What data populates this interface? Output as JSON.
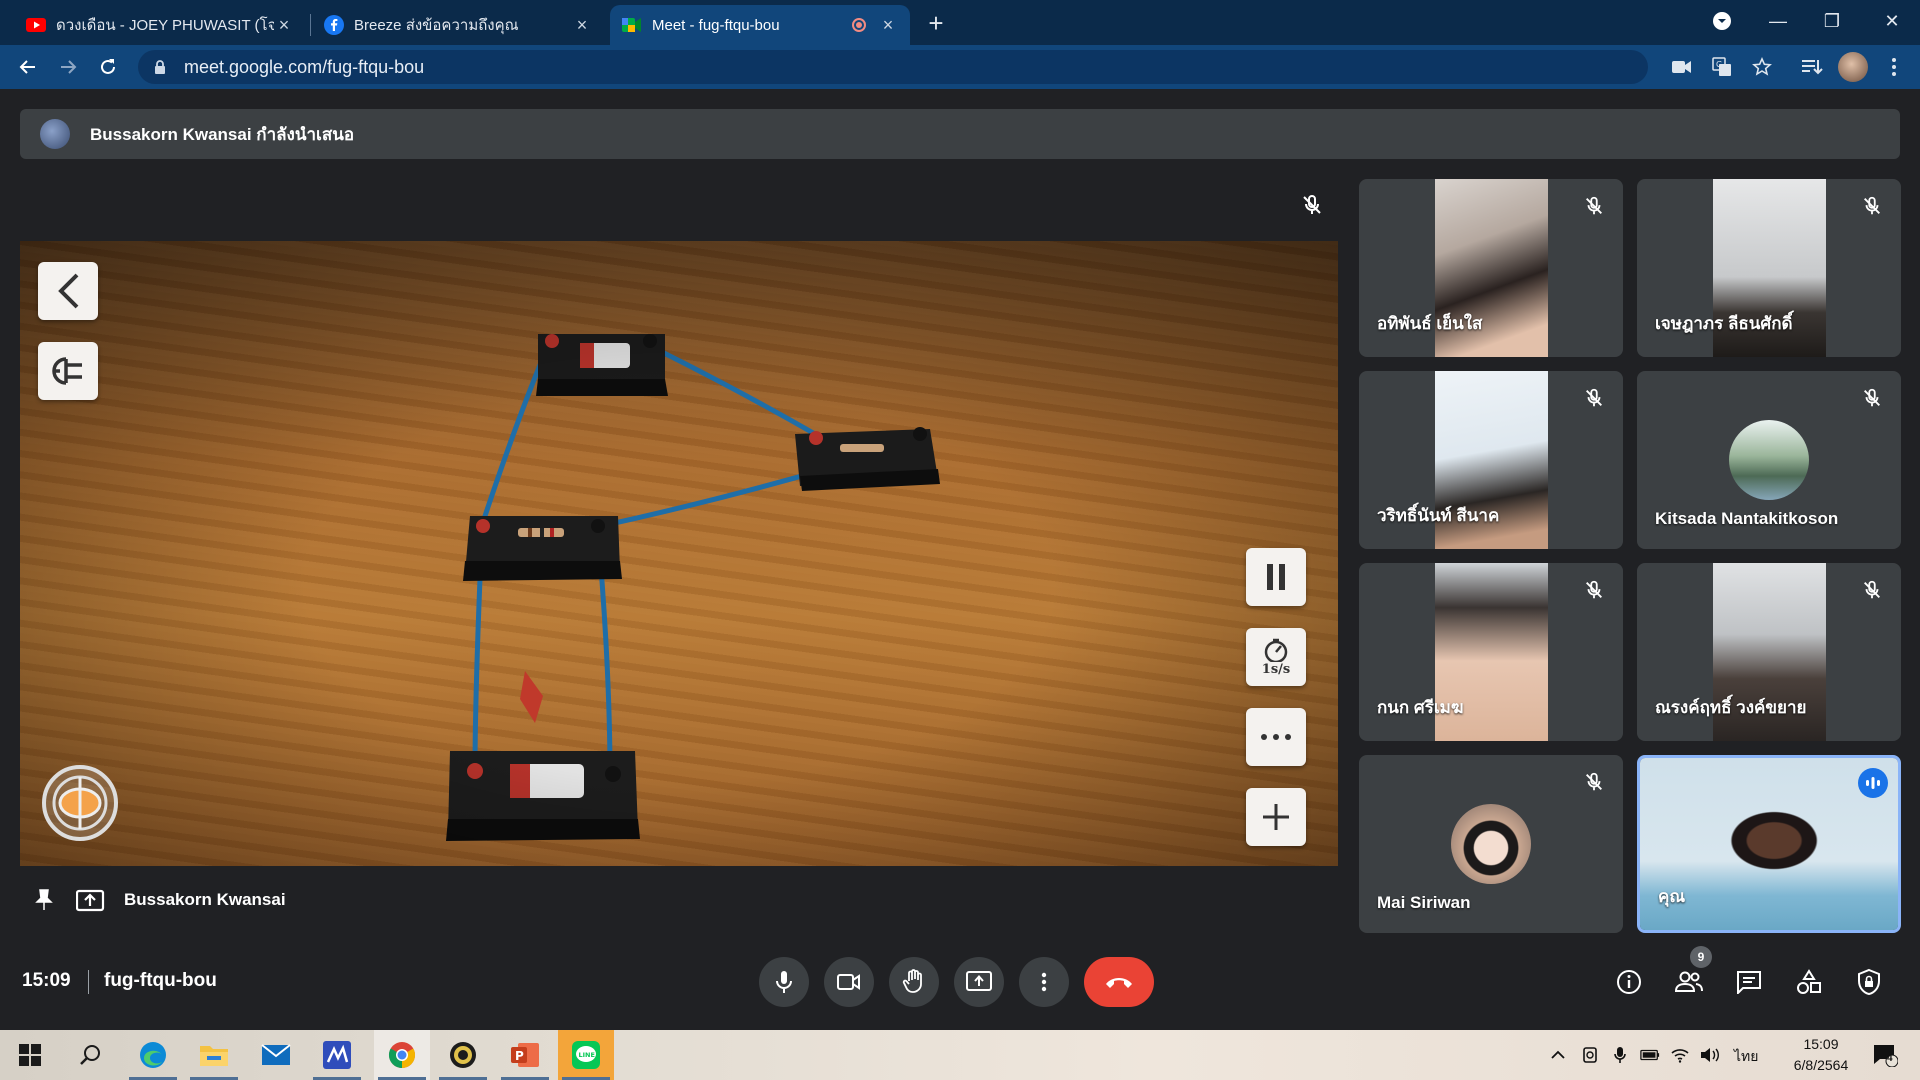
{
  "browser": {
    "tabs": [
      {
        "title": "ดวงเดือน - JOEY PHUWASIT (โจอี้ ภู",
        "favicon": "youtube-icon"
      },
      {
        "title": "Breeze ส่งข้อความถึงคุณ",
        "favicon": "facebook-icon"
      },
      {
        "title": "Meet - fug-ftqu-bou",
        "favicon": "meet-icon",
        "recording": true
      }
    ],
    "url": "meet.google.com/fug-ftqu-bou"
  },
  "meet": {
    "presenting_banner": "Bussakorn Kwansai กำลังนำเสนอ",
    "presenter_name": "Bussakorn Kwansai",
    "sim_speed_label": "1s/s",
    "participants": [
      {
        "name": "อทิพันธ์ เย็นใส",
        "muted": true
      },
      {
        "name": "เจษฎาภร ลีธนศักดิ์",
        "muted": true
      },
      {
        "name": "วริทธิ์นันท์ สีนาค",
        "muted": true
      },
      {
        "name": "Kitsada Nantakitkoson",
        "muted": true
      },
      {
        "name": "กนก ศรีเมฆ",
        "muted": true
      },
      {
        "name": "ณรงค์ฤทธิ์ วงค์ขยาย",
        "muted": true
      },
      {
        "name": "Mai Siriwan",
        "muted": true
      },
      {
        "name": "คุณ",
        "muted": false,
        "speaking": true
      }
    ],
    "time": "15:09",
    "meeting_code": "fug-ftqu-bou",
    "people_count": "9"
  },
  "taskbar": {
    "apps": [
      "start-icon",
      "search-icon",
      "edge-icon",
      "file-explorer-icon",
      "mail-icon",
      "whiteboard-icon",
      "chrome-icon",
      "app-icon",
      "powerpoint-icon",
      "line-icon"
    ],
    "language": "ไทย",
    "time": "15:09",
    "date": "6/8/2564",
    "notifications": "4"
  },
  "colors": {
    "tabbar": "#0b2a4a",
    "toolbar": "#11467b",
    "meet_bg": "#202124",
    "tile": "#3c4043",
    "end_call": "#ea4335",
    "speaking": "#8ab4f8"
  }
}
